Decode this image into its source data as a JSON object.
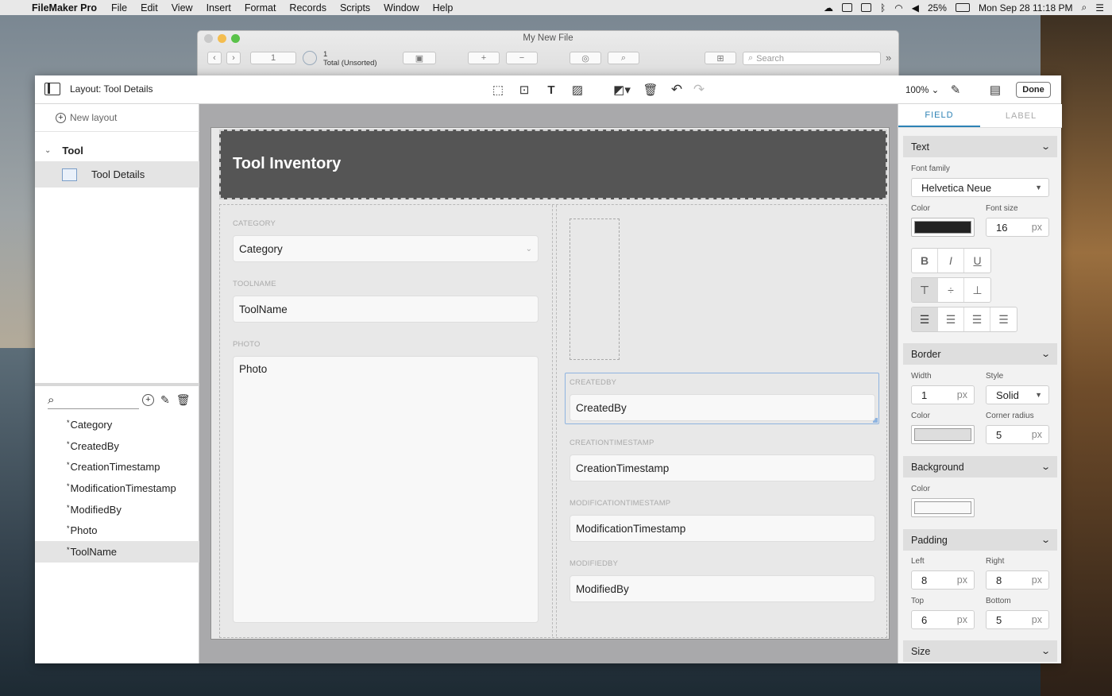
{
  "menubar": {
    "apple": "",
    "app_name": "FileMaker Pro",
    "menus": [
      "File",
      "Edit",
      "View",
      "Insert",
      "Format",
      "Records",
      "Scripts",
      "Window",
      "Help"
    ],
    "battery": "25%",
    "datetime": "Mon Sep 28  11:18 PM"
  },
  "file_window": {
    "title": "My New File",
    "record_number": "1",
    "total_count": "1",
    "total_label": "Total (Unsorted)",
    "search_placeholder": "Search"
  },
  "toolbar": {
    "layout_name": "Layout: Tool Details",
    "zoom": "100%",
    "done_label": "Done"
  },
  "left_pane": {
    "new_layout_label": "New layout",
    "group_name": "Tool",
    "layout_item": "Tool Details",
    "fields": [
      "Category",
      "CreatedBy",
      "CreationTimestamp",
      "ModificationTimestamp",
      "ModifiedBy",
      "Photo",
      "ToolName"
    ],
    "field_marker": "*",
    "selected_field": "ToolName"
  },
  "canvas": {
    "header_title": "Tool Inventory",
    "left_fields": [
      {
        "label": "CATEGORY",
        "value": "Category"
      },
      {
        "label": "TOOLNAME",
        "value": "ToolName"
      },
      {
        "label": "PHOTO",
        "value": "Photo"
      }
    ],
    "right_fields": [
      {
        "label": "CREATEDBY",
        "value": "CreatedBy"
      },
      {
        "label": "CREATIONTIMESTAMP",
        "value": "CreationTimestamp"
      },
      {
        "label": "MODIFICATIONTIMESTAMP",
        "value": "ModificationTimestamp"
      },
      {
        "label": "MODIFIEDBY",
        "value": "ModifiedBy"
      }
    ]
  },
  "inspector": {
    "tabs": [
      "FIELD",
      "LABEL"
    ],
    "active_tab": "FIELD",
    "text_section": {
      "title": "Text",
      "font_family_label": "Font family",
      "font_family": "Helvetica Neue",
      "color_label": "Color",
      "color": "#222222",
      "font_size_label": "Font size",
      "font_size": "16",
      "unit": "px"
    },
    "border_section": {
      "title": "Border",
      "width_label": "Width",
      "width": "1",
      "style_label": "Style",
      "style": "Solid",
      "color_label": "Color",
      "color": "#dddddd",
      "radius_label": "Corner radius",
      "radius": "5",
      "unit": "px"
    },
    "background_section": {
      "title": "Background",
      "color_label": "Color",
      "color": "#f8f8f8"
    },
    "padding_section": {
      "title": "Padding",
      "left_label": "Left",
      "left": "8",
      "right_label": "Right",
      "right": "8",
      "top_label": "Top",
      "top": "6",
      "bottom_label": "Bottom",
      "bottom": "5",
      "unit": "px"
    },
    "size_section": {
      "title": "Size"
    }
  },
  "colors": {
    "accent": "#2d82b5",
    "header_bg": "#555555",
    "selection": "#8fb4e0"
  }
}
